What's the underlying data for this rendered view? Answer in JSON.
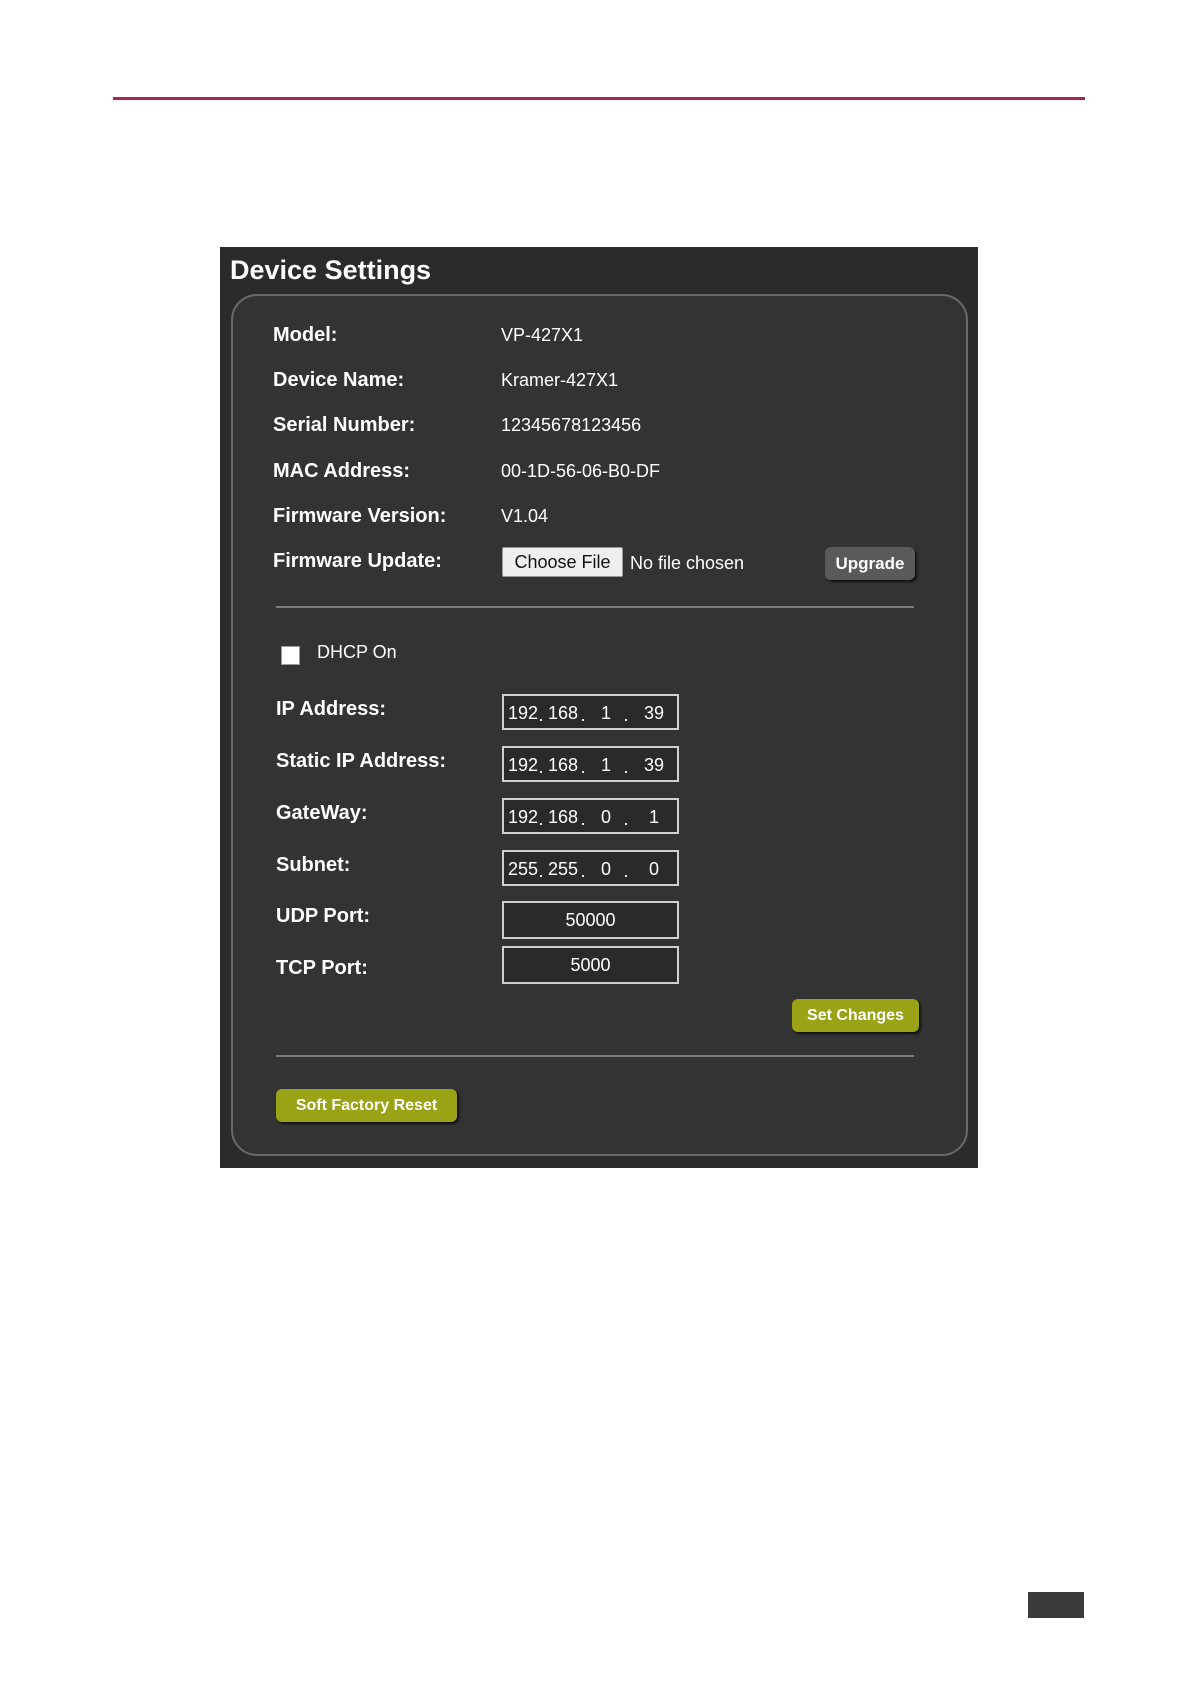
{
  "panel": {
    "title": "Device Settings"
  },
  "info": {
    "model_label": "Model:",
    "model_value": "VP-427X1",
    "device_name_label": "Device Name:",
    "device_name_value": "Kramer-427X1",
    "serial_label": "Serial Number:",
    "serial_value": "12345678123456",
    "mac_label": "MAC Address:",
    "mac_value": "00-1D-56-06-B0-DF",
    "fw_version_label": "Firmware Version:",
    "fw_version_value": "V1.04",
    "fw_update_label": "Firmware Update:",
    "choose_file_label": "Choose File",
    "no_file_text": "No file chosen",
    "upgrade_label": "Upgrade"
  },
  "network": {
    "dhcp_label": "DHCP On",
    "dhcp_checked": false,
    "ip_label": "IP Address:",
    "ip": [
      "192",
      "168",
      "1",
      "39"
    ],
    "static_ip_label": "Static IP Address:",
    "static_ip": [
      "192",
      "168",
      "1",
      "39"
    ],
    "gateway_label": "GateWay:",
    "gateway": [
      "192",
      "168",
      "0",
      "1"
    ],
    "subnet_label": "Subnet:",
    "subnet": [
      "255",
      "255",
      "0",
      "0"
    ],
    "udp_label": "UDP Port:",
    "udp_value": "50000",
    "tcp_label": "TCP Port:",
    "tcp_value": "5000",
    "dot_separator": ".",
    "set_changes_label": "Set Changes"
  },
  "reset": {
    "soft_factory_reset_label": "Soft Factory Reset"
  },
  "colors": {
    "accent_rule": "#a8264a",
    "button_green": "#9aa315",
    "panel_bg": "#2b2b2b"
  }
}
